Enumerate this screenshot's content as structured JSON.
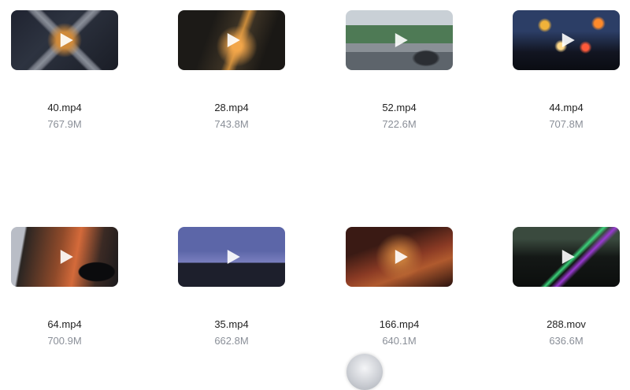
{
  "colors": {
    "name": "#222222",
    "size": "#8a8f98",
    "play": "#ffffff"
  },
  "videos": [
    {
      "name": "40.mp4",
      "size": "767.9M",
      "thumb_style": "aerial-interchange-night"
    },
    {
      "name": "28.mp4",
      "size": "743.8M",
      "thumb_style": "city-street-night"
    },
    {
      "name": "52.mp4",
      "size": "722.6M",
      "thumb_style": "rainy-street-day"
    },
    {
      "name": "44.mp4",
      "size": "707.8M",
      "thumb_style": "bokeh-lights"
    },
    {
      "name": "64.mp4",
      "size": "700.9M",
      "thumb_style": "person-traffic-night"
    },
    {
      "name": "35.mp4",
      "size": "662.8M",
      "thumb_style": "skyline-dusk"
    },
    {
      "name": "166.mp4",
      "size": "640.1M",
      "thumb_style": "wet-pavement-warm"
    },
    {
      "name": "288.mov",
      "size": "636.6M",
      "thumb_style": "neon-reflection"
    }
  ]
}
